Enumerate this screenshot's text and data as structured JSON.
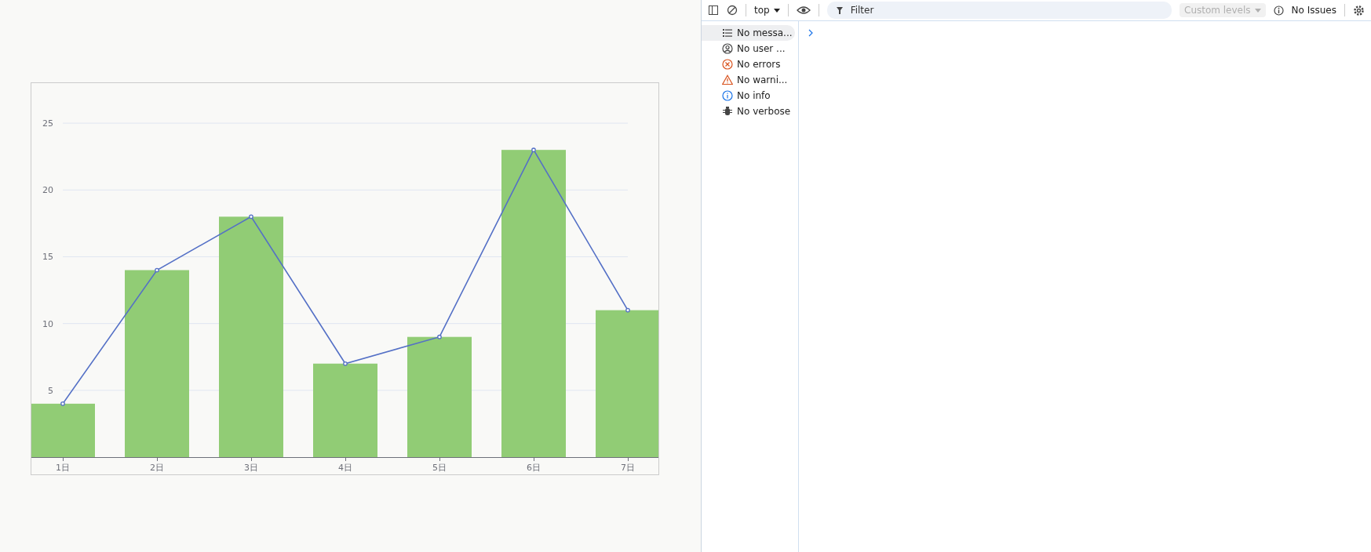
{
  "chart": {
    "chart_data": {
      "type": "bar",
      "categories": [
        "1日",
        "2日",
        "3日",
        "4日",
        "5日",
        "6日",
        "7日"
      ],
      "ylim": [
        0,
        28
      ],
      "yticks": [
        5,
        10,
        15,
        20,
        25
      ],
      "grid": true,
      "series": [
        {
          "type": "bar",
          "color": "#91cc75",
          "values": [
            4,
            14,
            18,
            7,
            9,
            23,
            11
          ]
        },
        {
          "type": "line",
          "color": "#5470c6",
          "marker": "circle",
          "values": [
            4,
            14,
            18,
            7,
            9,
            23,
            11
          ]
        }
      ]
    }
  },
  "devtools": {
    "toolbar": {
      "context": "top",
      "filter_placeholder": "Filter",
      "levels": {
        "label": "Custom levels",
        "disabled": true
      },
      "issues": "No Issues"
    },
    "sidebar": [
      {
        "kind": "messages",
        "label": "No messa...",
        "selected": true
      },
      {
        "kind": "user",
        "label": "No user ...",
        "selected": false
      },
      {
        "kind": "errors",
        "label": "No errors",
        "selected": false
      },
      {
        "kind": "warnings",
        "label": "No warni...",
        "selected": false
      },
      {
        "kind": "info",
        "label": "No info",
        "selected": false
      },
      {
        "kind": "verbose",
        "label": "No verbose",
        "selected": false
      }
    ]
  }
}
